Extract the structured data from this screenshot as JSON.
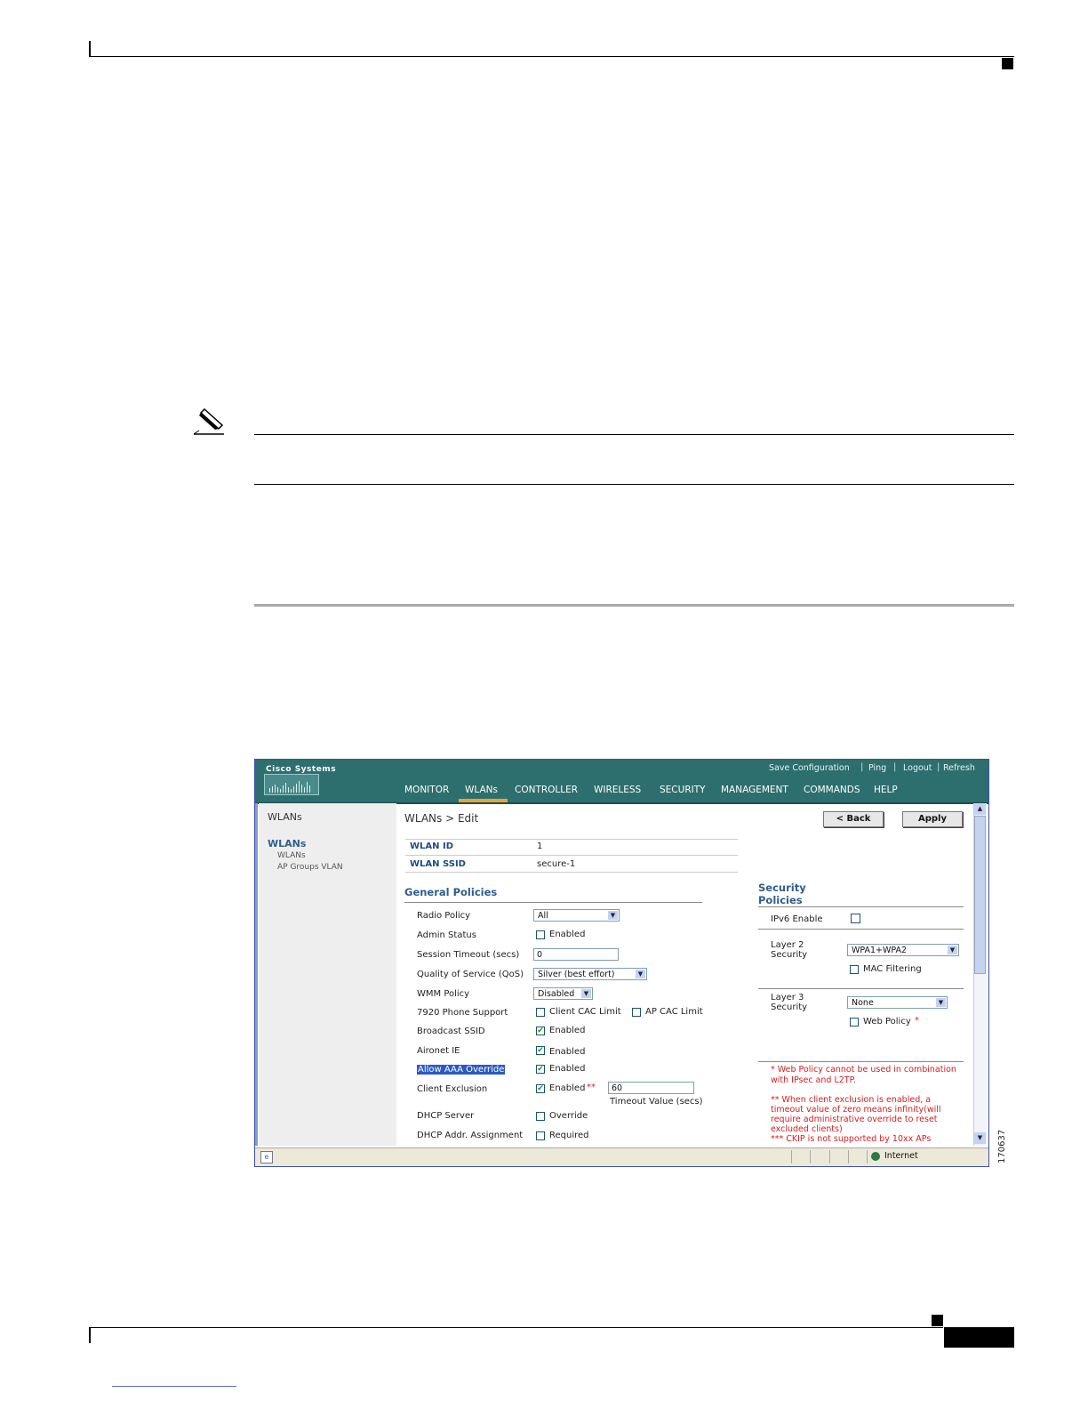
{
  "screenshot": {
    "brand": "Cisco Systems",
    "top_links": [
      "Save Configuration",
      "Ping",
      "Logout",
      "Refresh"
    ],
    "top_link_separator": "|",
    "nav": [
      "MONITOR",
      "WLANs",
      "CONTROLLER",
      "WIRELESS",
      "SECURITY",
      "MANAGEMENT",
      "COMMANDS",
      "HELP"
    ],
    "nav_active": "WLANs",
    "sidebar": {
      "title": "WLANs",
      "section": "WLANs",
      "items": [
        "WLANs",
        "AP Groups VLAN"
      ]
    },
    "page_title": "WLANs > Edit",
    "buttons": {
      "back": "< Back",
      "apply": "Apply"
    },
    "wlan_id": {
      "label": "WLAN ID",
      "value": "1"
    },
    "wlan_ssid": {
      "label": "WLAN SSID",
      "value": "secure-1"
    },
    "general_policies": {
      "title": "General Policies",
      "radio_policy": {
        "label": "Radio Policy",
        "value": "All"
      },
      "admin_status": {
        "label": "Admin Status",
        "option": "Enabled",
        "checked": false
      },
      "session_timeout": {
        "label": "Session Timeout (secs)",
        "value": "0"
      },
      "qos": {
        "label": "Quality of Service (QoS)",
        "value": "Silver (best effort)"
      },
      "wmm_policy": {
        "label": "WMM Policy",
        "value": "Disabled"
      },
      "phone_7920": {
        "label": "7920 Phone Support",
        "client_cac": "Client CAC Limit",
        "ap_cac": "AP CAC Limit"
      },
      "broadcast_ssid": {
        "label": "Broadcast SSID",
        "option": "Enabled",
        "checked": true
      },
      "aironet_ie": {
        "label": "Aironet IE",
        "option": "Enabled",
        "checked": true
      },
      "allow_aaa_override": {
        "label": "Allow AAA Override",
        "option": "Enabled",
        "checked": true
      },
      "client_exclusion": {
        "label": "Client Exclusion",
        "option": "Enabled",
        "marker": "**",
        "checked": true,
        "timeout_value": "60",
        "timeout_label": "Timeout Value (secs)"
      },
      "dhcp_server": {
        "label": "DHCP Server",
        "option": "Override",
        "checked": false
      },
      "dhcp_addr": {
        "label": "DHCP Addr. Assignment",
        "option": "Required",
        "checked": false
      }
    },
    "security_policies": {
      "title_line1": "Security",
      "title_line2": "Policies",
      "ipv6": {
        "label": "IPv6 Enable",
        "checked": false
      },
      "layer2": {
        "label_line1": "Layer 2",
        "label_line2": "Security",
        "value": "WPA1+WPA2",
        "mac_filtering": "MAC Filtering"
      },
      "layer3": {
        "label_line1": "Layer 3",
        "label_line2": "Security",
        "value": "None",
        "web_policy": "Web Policy",
        "marker": "*"
      }
    },
    "notes": {
      "n1_line1": "* Web Policy cannot be used in combination",
      "n1_line2": "with IPsec and L2TP.",
      "n2_line1": "** When client exclusion is enabled, a",
      "n2_line2": "timeout value of zero means infinity(will",
      "n2_line3": "require administrative override to reset",
      "n2_line4": "excluded clients)",
      "n3_line1": "*** CKIP is not supported by 10xx APs"
    },
    "status_bar": {
      "zone": "Internet"
    },
    "figure_number": "170637",
    "colors": {
      "header": "#2d6e6e",
      "nav_active": "#e8a33c",
      "note_red": "#d42020"
    }
  }
}
